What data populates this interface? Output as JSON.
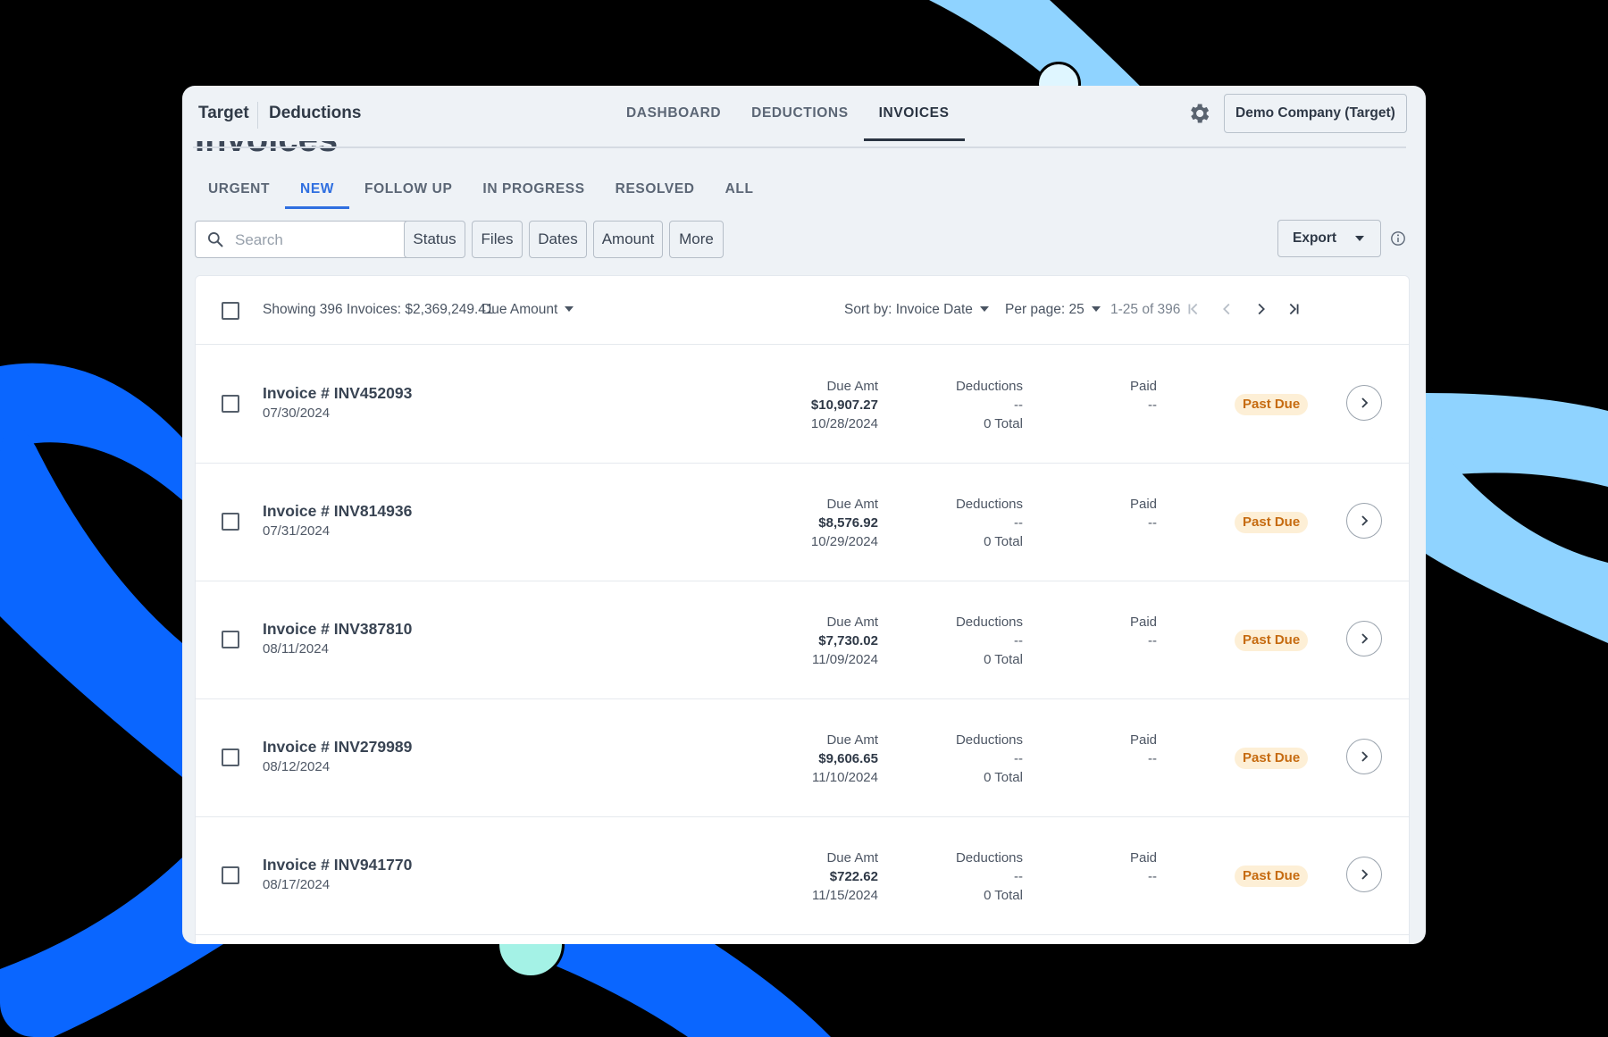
{
  "header": {
    "brand": "Target",
    "section": "Deductions",
    "nav": [
      {
        "label": "DASHBOARD",
        "active": false
      },
      {
        "label": "DEDUCTIONS",
        "active": false
      },
      {
        "label": "INVOICES",
        "active": true
      }
    ],
    "settings_icon": "gear-icon",
    "company_button": "Demo Company (Target)"
  },
  "page_title": "Invoices",
  "tabs": [
    {
      "label": "URGENT",
      "active": false
    },
    {
      "label": "NEW",
      "active": true
    },
    {
      "label": "FOLLOW UP",
      "active": false
    },
    {
      "label": "IN PROGRESS",
      "active": false
    },
    {
      "label": "RESOLVED",
      "active": false
    },
    {
      "label": "ALL",
      "active": false
    }
  ],
  "filters": {
    "search_placeholder": "Search",
    "search_value": "",
    "buttons": [
      "Status",
      "Files",
      "Dates",
      "Amount",
      "More"
    ],
    "export_label": "Export"
  },
  "list_header": {
    "summary": "Showing 396 Invoices: $2,369,249.41",
    "due_amount_label": "Due Amount",
    "sort_label": "Sort by: Invoice Date",
    "per_page_label": "Per page: 25",
    "range": "1-25 of 396"
  },
  "column_labels": {
    "due": "Due Amt",
    "deductions": "Deductions",
    "paid": "Paid"
  },
  "invoices": [
    {
      "title": "Invoice # INV452093",
      "date": "07/30/2024",
      "due_amount": "$10,907.27",
      "due_date": "10/28/2024",
      "deductions": "--",
      "deductions_total": "0 Total",
      "paid": "--",
      "status": "Past Due"
    },
    {
      "title": "Invoice # INV814936",
      "date": "07/31/2024",
      "due_amount": "$8,576.92",
      "due_date": "10/29/2024",
      "deductions": "--",
      "deductions_total": "0 Total",
      "paid": "--",
      "status": "Past Due"
    },
    {
      "title": "Invoice # INV387810",
      "date": "08/11/2024",
      "due_amount": "$7,730.02",
      "due_date": "11/09/2024",
      "deductions": "--",
      "deductions_total": "0 Total",
      "paid": "--",
      "status": "Past Due"
    },
    {
      "title": "Invoice # INV279989",
      "date": "08/12/2024",
      "due_amount": "$9,606.65",
      "due_date": "11/10/2024",
      "deductions": "--",
      "deductions_total": "0 Total",
      "paid": "--",
      "status": "Past Due"
    },
    {
      "title": "Invoice # INV941770",
      "date": "08/17/2024",
      "due_amount": "$722.62",
      "due_date": "11/15/2024",
      "deductions": "--",
      "deductions_total": "0 Total",
      "paid": "--",
      "status": "Past Due"
    }
  ],
  "colors": {
    "accent": "#2f6fe0",
    "status_bg": "#fdefd6",
    "status_text": "#c66b10",
    "ribbon_dark": "#0a66ff",
    "ribbon_light": "#8fd3ff"
  }
}
